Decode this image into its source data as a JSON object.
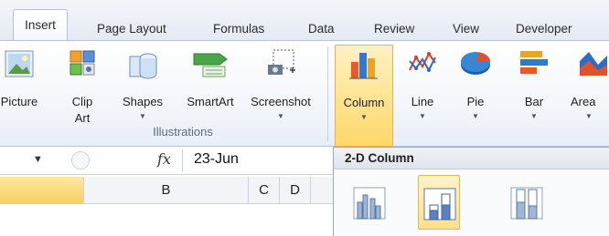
{
  "tabs": [
    {
      "label": "Insert",
      "active": true
    },
    {
      "label": "Page Layout"
    },
    {
      "label": "Formulas"
    },
    {
      "label": "Data"
    },
    {
      "label": "Review"
    },
    {
      "label": "View"
    },
    {
      "label": "Developer"
    }
  ],
  "ribbon": {
    "buttons": [
      {
        "label": "Picture",
        "icon": "picture-icon"
      },
      {
        "label": "Clip",
        "label2": "Art",
        "icon": "clip-art-icon"
      },
      {
        "label": "Shapes",
        "icon": "shapes-icon"
      },
      {
        "label": "SmartArt",
        "icon": "smartart-icon"
      },
      {
        "label": "Screenshot",
        "icon": "screenshot-icon"
      },
      {
        "label": "Column",
        "icon": "column-chart-icon",
        "selected": true
      },
      {
        "label": "Line",
        "icon": "line-chart-icon"
      },
      {
        "label": "Pie",
        "icon": "pie-chart-icon"
      },
      {
        "label": "Bar",
        "icon": "bar-chart-icon"
      },
      {
        "label": "Area",
        "icon": "area-chart-icon"
      }
    ],
    "group_label": "Illustrations"
  },
  "formula_bar": {
    "fx": "fx",
    "value": "23-Jun"
  },
  "columns": [
    "B",
    "C",
    "D"
  ],
  "dropdown": {
    "title": "2-D Column",
    "options": [
      {
        "icon": "clustered-column-icon"
      },
      {
        "icon": "stacked-column-icon",
        "selected": true
      },
      {
        "icon": "100-stacked-column-icon"
      }
    ]
  },
  "colors": {
    "accent": "#ffd869",
    "selected_border": "#e3b449",
    "ribbon_border": "#b6c3d6"
  }
}
